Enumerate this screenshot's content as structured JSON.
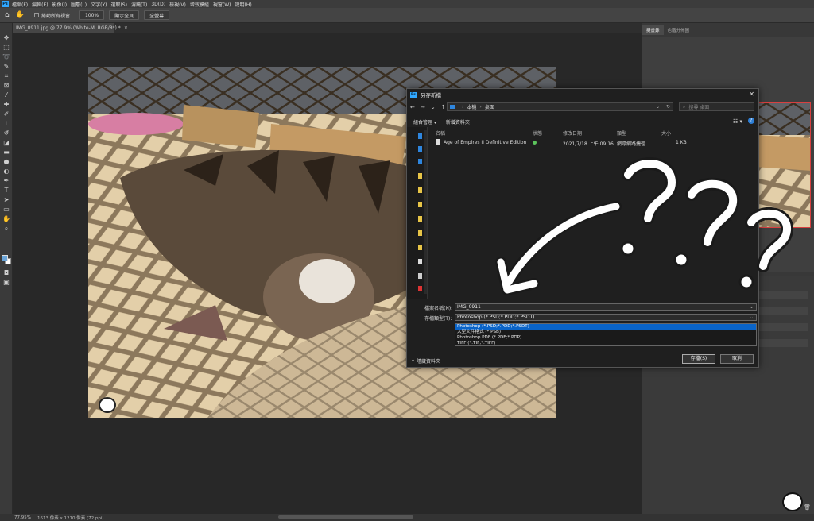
{
  "menubar": {
    "logo": "Ps",
    "items": [
      "檔案(F)",
      "編輯(E)",
      "影像(I)",
      "圖層(L)",
      "文字(Y)",
      "選取(S)",
      "濾鏡(T)",
      "3D(D)",
      "檢視(V)",
      "增效模組",
      "視窗(W)",
      "說明(H)"
    ]
  },
  "options": {
    "scroll_all_label": "捲動所有視窗",
    "zoom_value": "100%",
    "fit_screen_label": "顯示全頁",
    "fill_screen_label": "全螢幕"
  },
  "document": {
    "tab_title": "IMG_0911.jpg @ 77.9% (White-M, RGB/8*) *",
    "close_glyph": "×"
  },
  "panels": {
    "tab_history": "擬畫錄",
    "tab_layer_comps": "色階分佈圖"
  },
  "status": {
    "zoom": "77.95%",
    "doc_info": "1613 像素 x 1210 像素 (72 ppi)"
  },
  "dialog": {
    "title": "另存新檔",
    "app_icon": "Ps",
    "close_glyph": "✕",
    "nav": {
      "back": "←",
      "forward": "→",
      "recent": "⌄",
      "up": "↑"
    },
    "breadcrumb": [
      "本機",
      "桌面"
    ],
    "search_placeholder": "搜尋 桌面",
    "organize_label": "組合管理 ▾",
    "new_folder_label": "新增資料夾",
    "help_glyph": "?",
    "columns": {
      "name": "名稱",
      "status": "狀態",
      "modified": "修改日期",
      "type": "類型",
      "size": "大小"
    },
    "files": [
      {
        "name": "Age of Empires II Definitive Edition",
        "modified": "2021/7/18 上午 09:16",
        "type": "網際網路捷徑",
        "size": "1 KB"
      }
    ],
    "filename_label": "檔案名稱(N):",
    "filename_value": "IMG_0911",
    "filetype_label": "存檔類型(T):",
    "filetype_value": "Photoshop (*.PSD;*.PDD;*.PSDT)",
    "filetype_options": [
      "Photoshop (*.PSD;*.PDD;*.PSDT)",
      "大型文件格式 (*.PSB)",
      "Photoshop PDF (*.PDF;*.PDP)",
      "TIFF (*.TIF;*.TIFF)"
    ],
    "hide_folders_label": "隱藏資料夾",
    "save_label": "存檔(S)",
    "cancel_label": "取消"
  },
  "colors": {
    "accent": "#31a8ff",
    "selection": "#0a64c8",
    "thumbnail_border": "#d84040"
  }
}
